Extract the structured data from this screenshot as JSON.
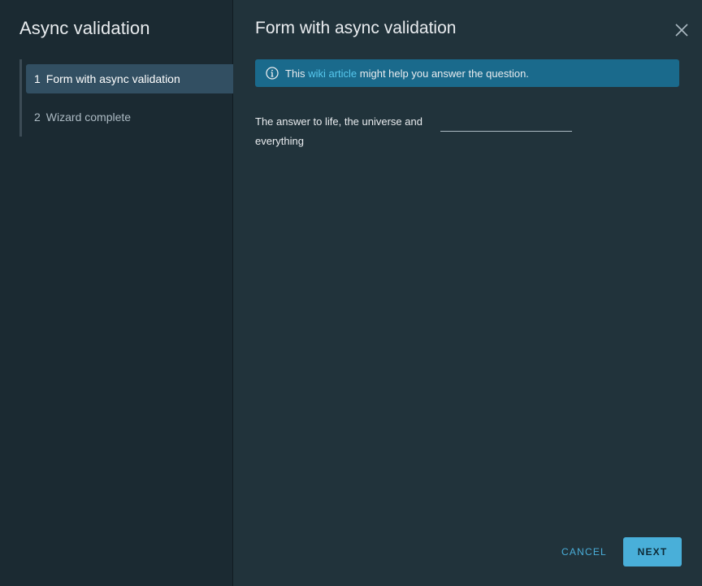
{
  "wizard": {
    "title": "Async validation",
    "steps": [
      {
        "number": "1",
        "label": "Form with async validation",
        "active": true
      },
      {
        "number": "2",
        "label": "Wizard complete",
        "active": false
      }
    ]
  },
  "page": {
    "title": "Form with async validation",
    "alert": {
      "prefix": "This",
      "link_text": "wiki article",
      "suffix": "might help you answer the question."
    },
    "field": {
      "label": "The answer to life, the universe and everything",
      "value": ""
    }
  },
  "footer": {
    "cancel_label": "CANCEL",
    "next_label": "NEXT"
  },
  "colors": {
    "sidebar_bg": "#1b2a32",
    "main_bg": "#21333b",
    "active_step_bg": "#324f62",
    "alert_bg": "#1a6a8c",
    "link": "#57c8ee",
    "primary_button": "#49afd9"
  },
  "icons": {
    "close": "close-icon",
    "alert": "info-circle-icon"
  }
}
